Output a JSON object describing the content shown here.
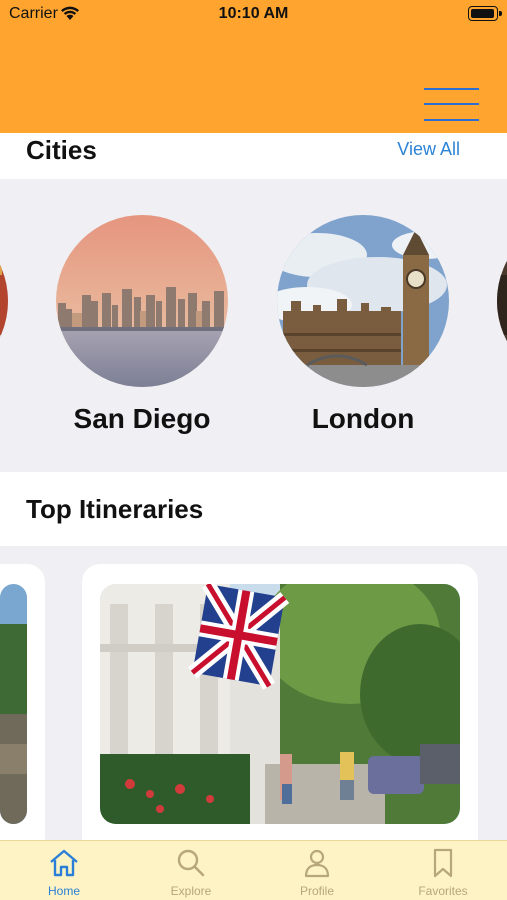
{
  "status_bar": {
    "carrier": "Carrier",
    "time": "10:10 AM"
  },
  "cities": {
    "title": "Cities",
    "view_all": "View All",
    "items": [
      {
        "name": "San Diego"
      },
      {
        "name": "London"
      }
    ]
  },
  "itineraries": {
    "title": "Top Itineraries"
  },
  "tabbar": {
    "items": [
      {
        "label": "Home",
        "icon": "home-icon",
        "active": true
      },
      {
        "label": "Explore",
        "icon": "search-icon",
        "active": false
      },
      {
        "label": "Profile",
        "icon": "person-icon",
        "active": false
      },
      {
        "label": "Favorites",
        "icon": "bookmark-icon",
        "active": false
      }
    ]
  },
  "colors": {
    "header": "#ffa52f",
    "accent": "#2c84d6",
    "tabbar": "#fdf3c4"
  }
}
